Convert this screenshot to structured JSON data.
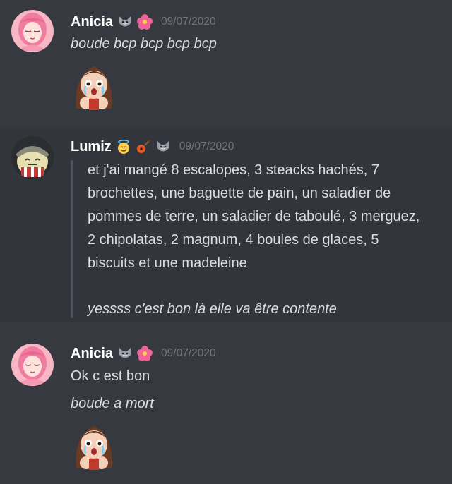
{
  "messages": [
    {
      "author": "Anicia",
      "badges": [
        "wolf-emoji",
        "hibiscus-emoji"
      ],
      "timestamp": "09/07/2020",
      "lines": [
        "boude bcp bcp bcp bcp"
      ],
      "sticker": "crying-girl-emote"
    },
    {
      "author": "Lumiz",
      "badges": [
        "halo-smile-emoji",
        "guitar-emoji",
        "wolf-emoji"
      ],
      "timestamp": "09/07/2020",
      "quote_lines": [
        "et j'ai mangé 8 escalopes, 3 steacks hachés, 7",
        "brochettes, une baguette de pain, un saladier de",
        "pommes de terre, un saladier de taboulé, 3 merguez,",
        "2 chipolatas, 2 magnum, 4 boules de glaces, 5",
        "biscuits et une madeleine"
      ],
      "quote_reply": "yessss c'est bon là elle va être contente"
    },
    {
      "author": "Anicia",
      "badges": [
        "wolf-emoji",
        "hibiscus-emoji"
      ],
      "timestamp": "09/07/2020",
      "lines": [
        "Ok c est bon",
        "boude a mort"
      ],
      "sticker": "crying-girl-emote"
    }
  ],
  "colors": {
    "background": "#36393f",
    "highlight": "#32353b",
    "username": "#ffffff",
    "text": "#dcddde",
    "timestamp": "#72767d",
    "quote_bar": "#4f545c"
  }
}
